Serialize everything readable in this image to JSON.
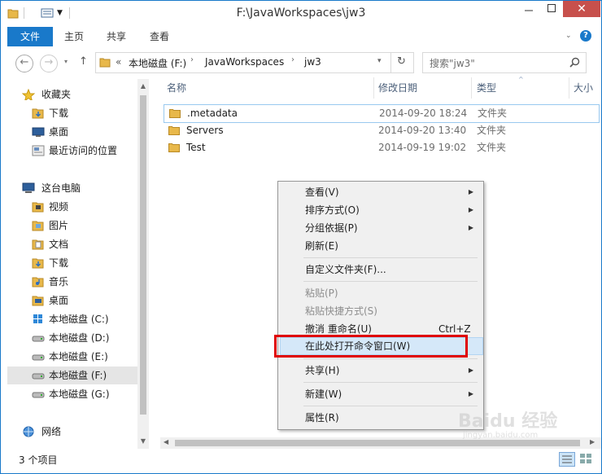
{
  "window": {
    "title": "F:\\JavaWorkspaces\\jw3",
    "minimize_icon": "minimize-icon",
    "maximize_icon": "maximize-icon",
    "close_label": "✕"
  },
  "ribbon": {
    "file_tab": "文件",
    "tabs": [
      "主页",
      "共享",
      "查看"
    ]
  },
  "address": {
    "overflow": "«",
    "crumbs": [
      "本地磁盘 (F:)",
      "JavaWorkspaces",
      "jw3"
    ],
    "search_placeholder": "搜索\"jw3\""
  },
  "sidebar": {
    "favorites": {
      "label": "收藏夹",
      "items": [
        "下载",
        "桌面",
        "最近访问的位置"
      ]
    },
    "this_pc": {
      "label": "这台电脑",
      "items": [
        "视频",
        "图片",
        "文档",
        "下载",
        "音乐",
        "桌面",
        "本地磁盘 (C:)",
        "本地磁盘 (D:)",
        "本地磁盘 (E:)",
        "本地磁盘 (F:)",
        "本地磁盘 (G:)"
      ]
    },
    "network": "网络"
  },
  "columns": {
    "name": "名称",
    "date": "修改日期",
    "type": "类型",
    "size": "大小"
  },
  "files": [
    {
      "name": ".metadata",
      "date": "2014-09-20 18:24",
      "type": "文件夹"
    },
    {
      "name": "Servers",
      "date": "2014-09-20 13:40",
      "type": "文件夹"
    },
    {
      "name": "Test",
      "date": "2014-09-19 19:02",
      "type": "文件夹"
    }
  ],
  "status": {
    "count": "3 个项目"
  },
  "context_menu": {
    "items": [
      {
        "label": "查看(V)"
      },
      {
        "label": "排序方式(O)"
      },
      {
        "label": "分组依据(P)"
      },
      {
        "label": "刷新(E)"
      },
      {
        "label": "自定义文件夹(F)..."
      },
      {
        "label": "粘贴(P)"
      },
      {
        "label": "粘贴快捷方式(S)"
      },
      {
        "label": "撤消 重命名(U)",
        "shortcut": "Ctrl+Z"
      },
      {
        "label": "在此处打开命令窗口(W)"
      },
      {
        "label": "共享(H)"
      },
      {
        "label": "新建(W)"
      },
      {
        "label": "属性(R)"
      }
    ]
  },
  "watermark": {
    "brand": "Baidu 经验",
    "url": "jingyan.baidu.com"
  },
  "colors": {
    "accent": "#1979ca",
    "highlight_box": "#e00000",
    "menu_hover": "#d5e8f9"
  }
}
